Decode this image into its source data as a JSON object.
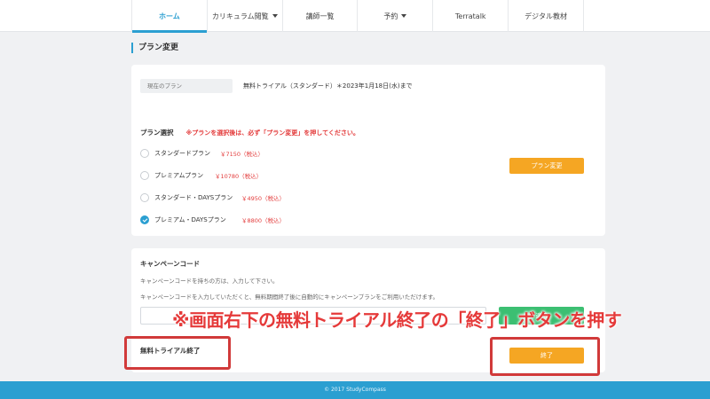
{
  "nav": {
    "items": [
      {
        "label": "ホーム",
        "active": true,
        "dropdown": false
      },
      {
        "label": "カリキュラム閲覧",
        "active": false,
        "dropdown": true
      },
      {
        "label": "講師一覧",
        "active": false,
        "dropdown": false
      },
      {
        "label": "予約",
        "active": false,
        "dropdown": true
      },
      {
        "label": "Terratalk",
        "active": false,
        "dropdown": false
      },
      {
        "label": "デジタル教材",
        "active": false,
        "dropdown": false
      }
    ]
  },
  "page": {
    "title": "プラン変更"
  },
  "current_plan": {
    "label": "現在のプラン",
    "value": "無料トライアル（スタンダード）＊2023年1月18日(水)まで"
  },
  "plan_select": {
    "title": "プラン選択",
    "warning": "※プランを選択後は、必ず「プラン変更」を押してください。",
    "plans": [
      {
        "name": "スタンダードプラン",
        "price": "￥7150（税込）",
        "checked": false
      },
      {
        "name": "プレミアムプラン",
        "price": "￥10780（税込）",
        "checked": false
      },
      {
        "name": "スタンダード・DAYSプラン",
        "price": "￥4950（税込）",
        "checked": false
      },
      {
        "name": "プレミアム・DAYSプラン",
        "price": "￥8800（税込）",
        "checked": true
      }
    ],
    "change_button": "プラン変更"
  },
  "campaign": {
    "title": "キャンペーンコード",
    "desc1": "キャンペーンコードを持ちの方は、入力して下さい。",
    "desc2": "キャンペーンコードを入力していただくと、無料期間終了後に自動的にキャンペーンプランをご利用いただけます。",
    "input_value": "",
    "apply_button": "適用"
  },
  "trial_end": {
    "title": "無料トライアル終了",
    "end_button": "終了"
  },
  "annotation": {
    "text": "※画面右下の無料トライアル終了の「終了」ボタンを押す",
    "color": "#e53a3a"
  },
  "footer": {
    "copyright": "© 2017 StudyCompass"
  },
  "colors": {
    "accent": "#2b9fd1",
    "warning": "#e33b3b",
    "orange_button": "#f5a623",
    "green_button": "#3cbf72"
  }
}
